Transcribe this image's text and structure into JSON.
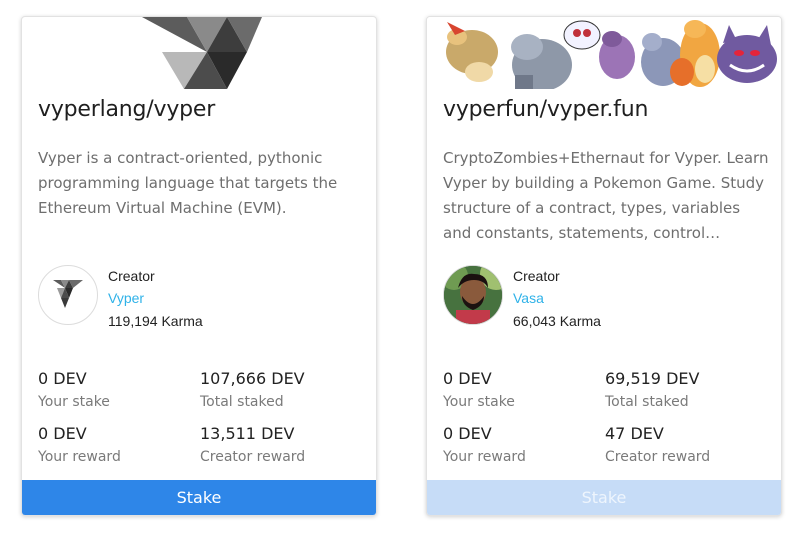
{
  "cards": [
    {
      "title": "vyperlang/vyper",
      "description": "Vyper is a contract-oriented, pythonic programming language that targets the Ethereum Virtual Machine (EVM).",
      "creator": {
        "role": "Creator",
        "name": "Vyper",
        "karma": "119,194 Karma"
      },
      "stats": {
        "your_stake": {
          "value": "0 DEV",
          "label": "Your stake"
        },
        "total_staked": {
          "value": "107,666 DEV",
          "label": "Total staked"
        },
        "your_reward": {
          "value": "0 DEV",
          "label": "Your reward"
        },
        "creator_reward": {
          "value": "13,511 DEV",
          "label": "Creator reward"
        }
      },
      "button": "Stake",
      "button_color": "#2e86e8"
    },
    {
      "title": "vyperfun/vyper.fun",
      "description": "CryptoZombies+Ethernaut for Vyper. Learn Vyper by building a Pokemon Game. Study structure of a contract, types, variables and constants, statements, control structures, functions and more.",
      "creator": {
        "role": "Creator",
        "name": "Vasa",
        "karma": "66,043 Karma"
      },
      "stats": {
        "your_stake": {
          "value": "0 DEV",
          "label": "Your stake"
        },
        "total_staked": {
          "value": "69,519 DEV",
          "label": "Total staked"
        },
        "your_reward": {
          "value": "0 DEV",
          "label": "Your reward"
        },
        "creator_reward": {
          "value": "47 DEV",
          "label": "Creator reward"
        }
      },
      "button": "Stake",
      "button_color": "#c6dcf7"
    }
  ],
  "colors": {
    "link": "#2fb2e8",
    "muted_text": "#7a7a7a"
  }
}
